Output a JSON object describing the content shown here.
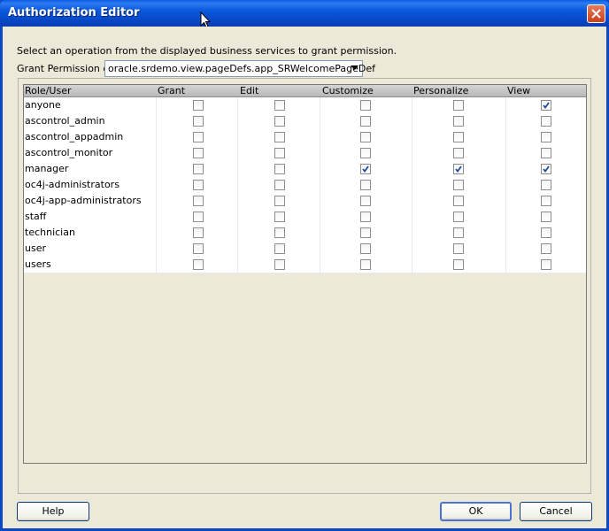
{
  "window": {
    "title": "Authorization Editor"
  },
  "instruction": "Select an operation from the displayed business services to grant permission.",
  "grant_on": {
    "label": "Grant Permission on:",
    "selected": "oracle.srdemo.view.pageDefs.app_SRWelcomePageDef"
  },
  "table": {
    "columns": [
      "Role/User",
      "Grant",
      "Edit",
      "Customize",
      "Personalize",
      "View"
    ],
    "rows": [
      {
        "role": "anyone",
        "grant": false,
        "edit": false,
        "customize": false,
        "personalize": false,
        "view": true
      },
      {
        "role": "ascontrol_admin",
        "grant": false,
        "edit": false,
        "customize": false,
        "personalize": false,
        "view": false
      },
      {
        "role": "ascontrol_appadmin",
        "grant": false,
        "edit": false,
        "customize": false,
        "personalize": false,
        "view": false
      },
      {
        "role": "ascontrol_monitor",
        "grant": false,
        "edit": false,
        "customize": false,
        "personalize": false,
        "view": false
      },
      {
        "role": "manager",
        "grant": false,
        "edit": false,
        "customize": true,
        "personalize": true,
        "view": true
      },
      {
        "role": "oc4j-administrators",
        "grant": false,
        "edit": false,
        "customize": false,
        "personalize": false,
        "view": false
      },
      {
        "role": "oc4j-app-administrators",
        "grant": false,
        "edit": false,
        "customize": false,
        "personalize": false,
        "view": false
      },
      {
        "role": "staff",
        "grant": false,
        "edit": false,
        "customize": false,
        "personalize": false,
        "view": false
      },
      {
        "role": "technician",
        "grant": false,
        "edit": false,
        "customize": false,
        "personalize": false,
        "view": false
      },
      {
        "role": "user",
        "grant": false,
        "edit": false,
        "customize": false,
        "personalize": false,
        "view": false
      },
      {
        "role": "users",
        "grant": false,
        "edit": false,
        "customize": false,
        "personalize": false,
        "view": false
      }
    ]
  },
  "buttons": {
    "help": "Help",
    "ok": "OK",
    "cancel": "Cancel"
  },
  "icons": {
    "close": "close-icon",
    "dropdown": "chevron-down-icon",
    "cursor": "mouse-pointer-icon",
    "check": "checkmark-icon"
  },
  "colors": {
    "titlebar": "#0a58dc",
    "check": "#1a4c9c",
    "dialog": "#ece9d8"
  }
}
